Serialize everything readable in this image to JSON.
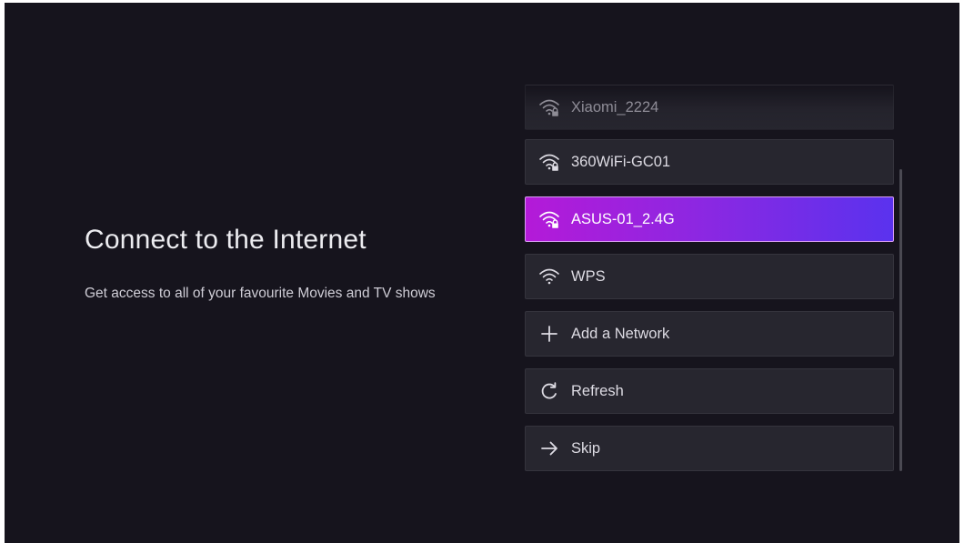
{
  "page": {
    "title": "Connect to the Internet",
    "subtitle": "Get access to all of your favourite Movies and TV shows"
  },
  "networks": [
    {
      "label": "Xiaomi_2224",
      "icon": "wifi-lock-icon",
      "state": "faded"
    },
    {
      "label": "360WiFi-GC01",
      "icon": "wifi-lock-icon",
      "state": "normal"
    },
    {
      "label": "ASUS-01_2.4G",
      "icon": "wifi-lock-icon",
      "state": "selected"
    },
    {
      "label": "WPS",
      "icon": "wifi-icon",
      "state": "normal"
    },
    {
      "label": "Add a Network",
      "icon": "plus-icon",
      "state": "normal"
    },
    {
      "label": "Refresh",
      "icon": "refresh-icon",
      "state": "normal"
    },
    {
      "label": "Skip",
      "icon": "arrow-right-icon",
      "state": "normal"
    }
  ],
  "colors": {
    "background": "#16141d",
    "item_background": "#27262f",
    "selected_gradient_start": "#b41ad8",
    "selected_gradient_end": "#5a32ee"
  }
}
